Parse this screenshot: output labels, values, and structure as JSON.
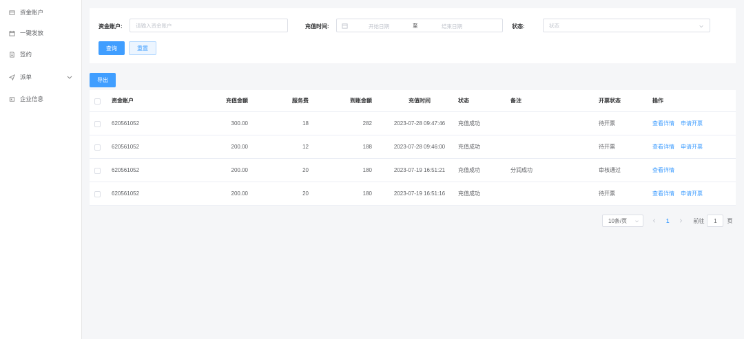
{
  "sidebar": {
    "items": [
      {
        "label": "资金账户",
        "icon": "wallet-icon"
      },
      {
        "label": "一键发放",
        "icon": "send-batch-icon"
      },
      {
        "label": "签约",
        "icon": "contract-icon"
      },
      {
        "label": "派单",
        "icon": "dispatch-icon"
      },
      {
        "label": "企业信息",
        "icon": "company-icon"
      }
    ]
  },
  "filters": {
    "account_label": "资金账户:",
    "account_placeholder": "请输入资金账户",
    "time_label": "充值时间:",
    "start_placeholder": "开始日期",
    "range_sep": "至",
    "end_placeholder": "结束日期",
    "status_label": "状态:",
    "status_placeholder": "状态",
    "query_label": "查询",
    "reset_label": "重置"
  },
  "export_label": "导出",
  "table": {
    "headers": [
      "资金账户",
      "充值金额",
      "服务费",
      "到账金额",
      "充值时间",
      "状态",
      "备注",
      "开票状态",
      "操作"
    ],
    "rows": [
      {
        "account": "620561052",
        "amount": "300.00",
        "fee": "18",
        "received": "282",
        "time": "2023-07-28 09:47:46",
        "status": "充值成功",
        "remark": "",
        "invoice": "待开票",
        "actions": [
          "查看详情",
          "申请开票"
        ]
      },
      {
        "account": "620561052",
        "amount": "200.00",
        "fee": "12",
        "received": "188",
        "time": "2023-07-28 09:46:00",
        "status": "充值成功",
        "remark": "",
        "invoice": "待开票",
        "actions": [
          "查看详情",
          "申请开票"
        ]
      },
      {
        "account": "620561052",
        "amount": "200.00",
        "fee": "20",
        "received": "180",
        "time": "2023-07-19 16:51:21",
        "status": "充值成功",
        "remark": "分润成功",
        "invoice": "审核通过",
        "actions": [
          "查看详情"
        ]
      },
      {
        "account": "620561052",
        "amount": "200.00",
        "fee": "20",
        "received": "180",
        "time": "2023-07-19 16:51:16",
        "status": "充值成功",
        "remark": "",
        "invoice": "待开票",
        "actions": [
          "查看详情",
          "申请开票"
        ]
      }
    ]
  },
  "pagination": {
    "page_size": "10条/页",
    "current_page": "1",
    "goto_label": "前往",
    "goto_value": "1",
    "page_unit": "页"
  },
  "colors": {
    "primary": "#409eff",
    "background": "#f5f6f8"
  }
}
